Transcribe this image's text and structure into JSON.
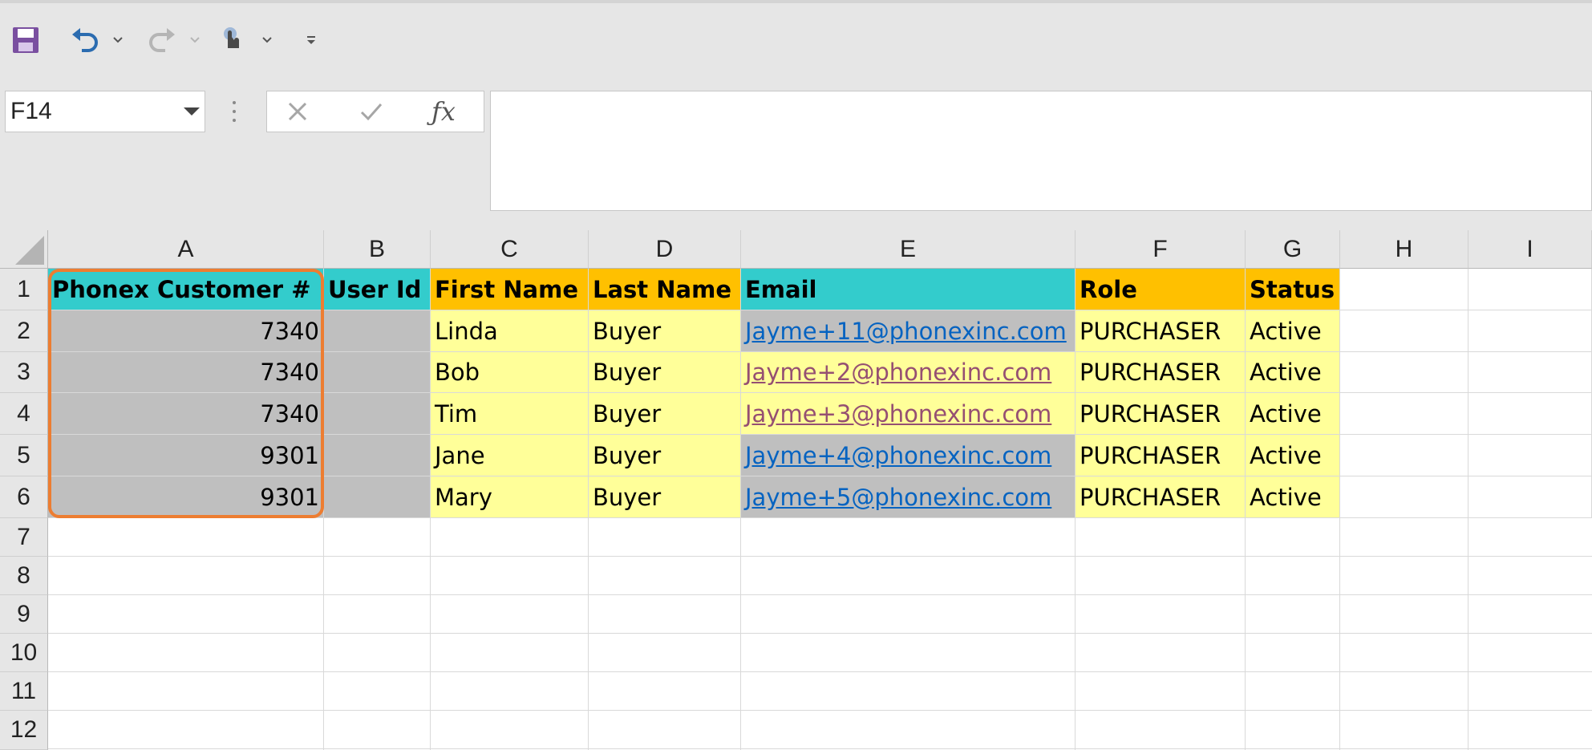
{
  "name_box": "F14",
  "formula_content": "",
  "columns": [
    "A",
    "B",
    "C",
    "D",
    "E",
    "F",
    "G",
    "H",
    "I"
  ],
  "rows": [
    "1",
    "2",
    "3",
    "4",
    "5",
    "6",
    "7",
    "8",
    "9",
    "10",
    "11",
    "12"
  ],
  "headers": [
    "Phonex Customer #",
    "User Id",
    "First Name",
    "Last Name",
    "Email",
    "Role",
    "Status"
  ],
  "data": [
    {
      "customer": "7340",
      "user_id": "",
      "first": "Linda",
      "last": "Buyer",
      "email": "Jayme+11@phonexinc.com",
      "role": "PURCHASER",
      "status": "Active"
    },
    {
      "customer": "7340",
      "user_id": "",
      "first": "Bob",
      "last": "Buyer",
      "email": "Jayme+2@phonexinc.com",
      "role": "PURCHASER",
      "status": "Active"
    },
    {
      "customer": "7340",
      "user_id": "",
      "first": "Tim",
      "last": "Buyer",
      "email": "Jayme+3@phonexinc.com",
      "role": "PURCHASER",
      "status": "Active"
    },
    {
      "customer": "9301",
      "user_id": "",
      "first": "Jane",
      "last": "Buyer",
      "email": "Jayme+4@phonexinc.com",
      "role": "PURCHASER",
      "status": "Active"
    },
    {
      "customer": "9301",
      "user_id": "",
      "first": "Mary",
      "last": "Buyer",
      "email": "Jayme+5@phonexinc.com",
      "role": "PURCHASER",
      "status": "Active"
    }
  ],
  "colors": {
    "header_teal": "#33cccc",
    "header_orange": "#ffc000",
    "fill_gray": "#bfbfbf",
    "fill_yellow": "#ffff99",
    "selection_outline": "#ed7d31",
    "link": "#0563c1",
    "link_visited": "#954f72"
  },
  "icons": {
    "save": "save-icon",
    "undo": "undo-icon",
    "redo": "redo-icon",
    "touch": "touch-mode-icon",
    "customize": "customize-toolbar-icon",
    "cancel": "cancel-icon",
    "enter": "enter-icon",
    "function": "insert-function-icon"
  }
}
